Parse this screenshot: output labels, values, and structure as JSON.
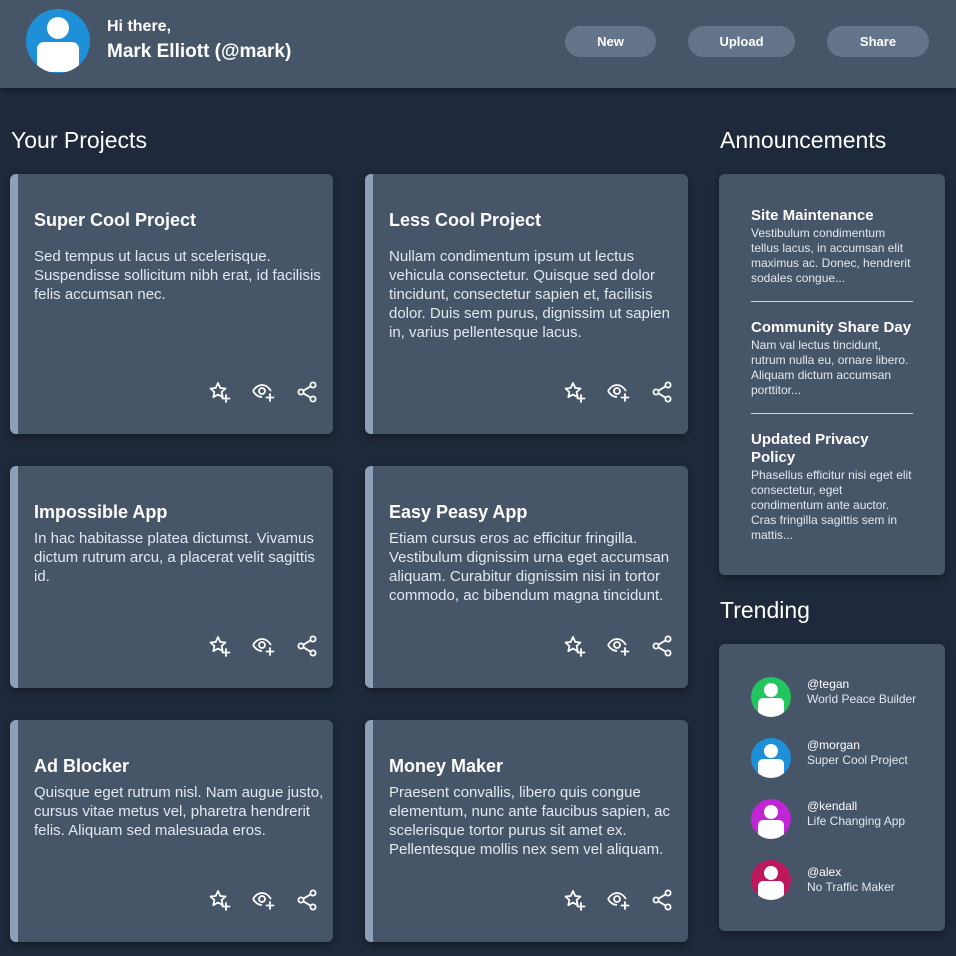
{
  "header": {
    "greeting": "Hi there,",
    "username": "Mark Elliott (@mark)",
    "buttons": {
      "new": "New",
      "upload": "Upload",
      "share": "Share"
    },
    "avatar_color": "#1e90d8"
  },
  "projects": {
    "title": "Your Projects",
    "items": [
      {
        "title": "Super Cool Project",
        "description": "Sed tempus ut lacus ut scelerisque. Suspendisse sollicitum nibh erat, id facilisis felis accumsan nec."
      },
      {
        "title": "Less Cool Project",
        "description": "Nullam condimentum ipsum ut lectus vehicula consectetur. Quisque sed dolor tincidunt, consectetur sapien et, facilisis dolor. Duis sem purus, dignissim ut sapien in, varius pellentesque lacus."
      },
      {
        "title": "Impossible App",
        "description": "In hac habitasse platea dictumst. Vivamus dictum rutrum arcu, a placerat velit sagittis id."
      },
      {
        "title": "Easy Peasy App",
        "description": "Etiam cursus eros ac efficitur fringilla. Vestibulum dignissim urna eget accumsan aliquam. Curabitur dignissim nisi in tortor commodo, ac bibendum magna tincidunt."
      },
      {
        "title": "Ad Blocker",
        "description": "Quisque eget rutrum nisl. Nam augue justo, cursus vitae metus vel, pharetra hendrerit felis. Aliquam sed malesuada eros."
      },
      {
        "title": "Money Maker",
        "description": "Praesent convallis, libero quis congue elementum, nunc ante faucibus sapien, ac scelerisque tortor purus sit amet ex. Pellentesque mollis nex sem vel aliquam."
      }
    ],
    "card_icons": [
      "star-plus-icon",
      "eye-plus-icon",
      "share-icon"
    ]
  },
  "announcements": {
    "title": "Announcements",
    "items": [
      {
        "title": "Site Maintenance",
        "text": "Vestibulum condimentum tellus lacus, in accumsan elit maximus ac. Donec, hendrerit sodales congue..."
      },
      {
        "title": "Community Share Day",
        "text": "Nam val lectus tincidunt, rutrum nulla eu, ornare libero. Aliquam dictum accumsan porttitor..."
      },
      {
        "title": "Updated Privacy Policy",
        "text": "Phasellus efficitur nisi eget elit consectetur, eget condimentum ante auctor. Cras fringilla sagittis sem in mattis..."
      }
    ]
  },
  "trending": {
    "title": "Trending",
    "items": [
      {
        "handle": "@tegan",
        "project": "World Peace Builder",
        "color": "#22c55e"
      },
      {
        "handle": "@morgan",
        "project": "Super Cool Project",
        "color": "#1e90d8"
      },
      {
        "handle": "@kendall",
        "project": "Life Changing App",
        "color": "#c026d3"
      },
      {
        "handle": "@alex",
        "project": "No Traffic Maker",
        "color": "#be185d"
      }
    ]
  }
}
